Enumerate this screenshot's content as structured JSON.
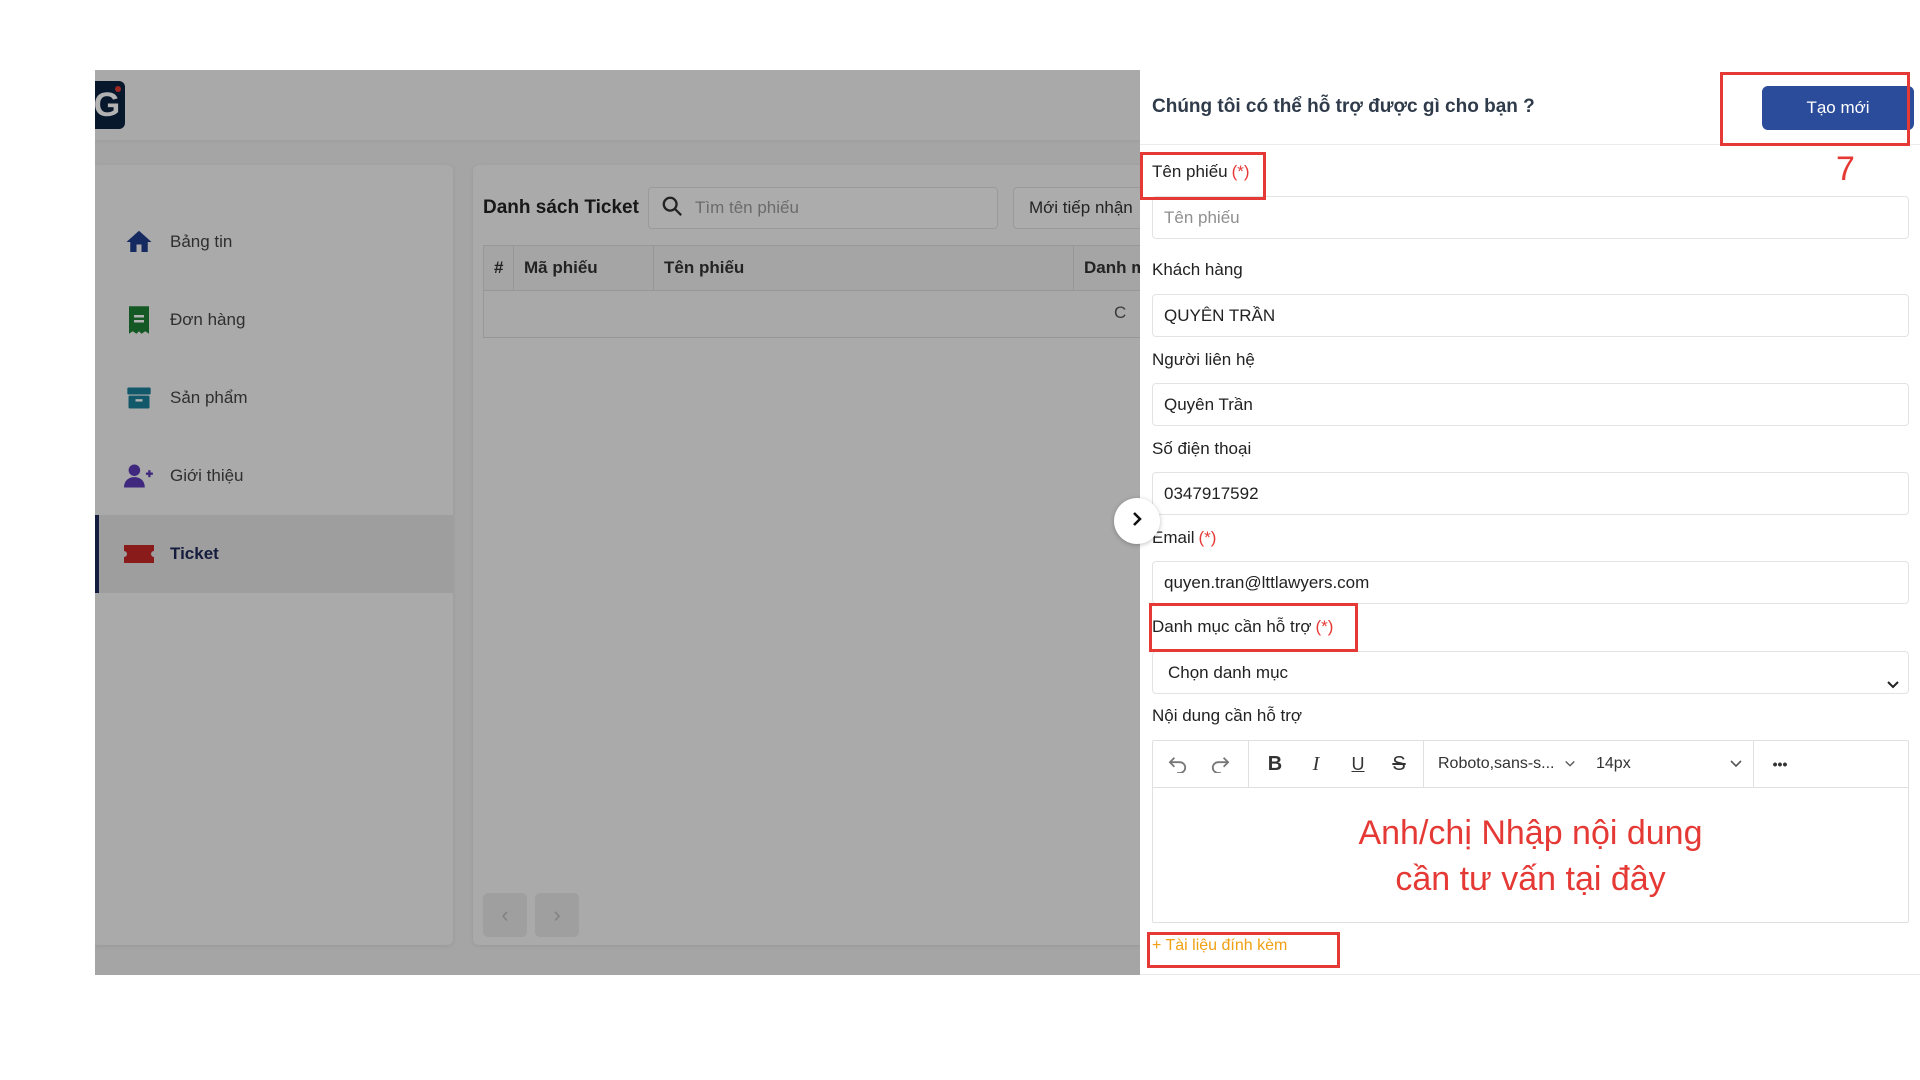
{
  "sidebar": {
    "items": [
      {
        "label": "Bảng tin",
        "icon": "home-icon"
      },
      {
        "label": "Đơn hàng",
        "icon": "receipt-icon"
      },
      {
        "label": "Sản phẩm",
        "icon": "archive-box-icon"
      },
      {
        "label": "Giới thiệu",
        "icon": "user-plus-icon"
      },
      {
        "label": "Ticket",
        "icon": "ticket-icon"
      }
    ],
    "active_index": 4
  },
  "ticket_list": {
    "title": "Danh sách Ticket",
    "search_placeholder": "Tìm tên phiếu",
    "status_filter": "Mới tiếp nhận",
    "columns": [
      "#",
      "Mã phiếu",
      "Tên phiếu",
      "Danh m"
    ],
    "empty_fragment": "C"
  },
  "drawer": {
    "title": "Chúng tôi có thể hỗ trợ được gì cho bạn ?",
    "create_button": "Tạo mới",
    "required_mark": "(*)",
    "fields": {
      "ticket_name": {
        "label": "Tên phiếu",
        "placeholder": "Tên phiếu",
        "value": ""
      },
      "customer": {
        "label": "Khách hàng",
        "value": "QUYÊN TRẦN"
      },
      "contact": {
        "label": "Người liên hệ",
        "value": "Quyên Trần"
      },
      "phone": {
        "label": "Số điện thoại",
        "value": "0347917592"
      },
      "email": {
        "label": "Email",
        "value": "quyen.tran@lttlawyers.com"
      },
      "category": {
        "label": "Danh mục cần hỗ trợ",
        "value": "Chọn danh mục"
      },
      "content": {
        "label": "Nội dung cần hỗ trợ"
      }
    },
    "editor": {
      "font_family": "Roboto,sans-s...",
      "font_size": "14px",
      "more_label": "•••",
      "placeholder_line1": "Anh/chị Nhập nội dung",
      "placeholder_line2": "cần tư vấn tại đây"
    },
    "attachment_label": "+ Tài liệu đính kèm"
  },
  "annotation": {
    "step_number": "7"
  },
  "colors": {
    "primary": "#2b4c9b",
    "required": "#e53935",
    "annotation": "#e53935",
    "attachment": "#f0a012",
    "sidebar_active": "#1f2a5a"
  }
}
